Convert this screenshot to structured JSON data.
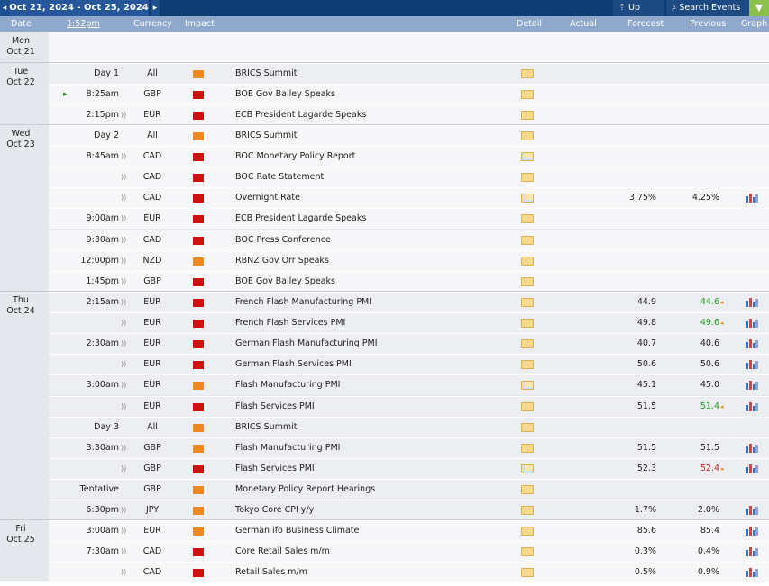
{
  "toolbar": {
    "prev_icon": "◂",
    "date_range": "Oct 21, 2024 - Oct 25, 2024",
    "next_icon": "▸",
    "up_next": "Up Next",
    "search_events": "Search Events",
    "filter_icon": "▼"
  },
  "header": {
    "date": "Date",
    "time": "1:52pm",
    "currency": "Currency",
    "impact": "Impact",
    "detail": "Detail",
    "actual": "Actual",
    "forecast": "Forecast",
    "previous": "Previous",
    "graph": "Graph"
  },
  "colors": {
    "high": "#cc1111",
    "medium": "#ee8822",
    "better": "#1f9e1f",
    "worse": "#cc2222"
  },
  "days": [
    {
      "day": "Mon",
      "date": "Oct 21",
      "rows": []
    },
    {
      "day": "Tue",
      "date": "Oct 22",
      "rows": [
        {
          "time": "Day 1",
          "sound": false,
          "cur": "All",
          "impact": "medium",
          "event": "BRICS Summit",
          "alt": true,
          "forecast": "",
          "previous": "",
          "prev_color": "",
          "graph": false
        },
        {
          "time": "8:25am",
          "sound": false,
          "cur": "GBP",
          "impact": "high",
          "event": "BOE Gov Bailey Speaks",
          "alt": false,
          "forecast": "",
          "previous": "",
          "prev_color": "",
          "graph": false,
          "playing": true
        },
        {
          "time": "2:15pm",
          "sound": true,
          "cur": "EUR",
          "impact": "high",
          "event": "ECB President Lagarde Speaks",
          "alt": false,
          "forecast": "",
          "previous": "",
          "prev_color": "",
          "graph": false
        }
      ]
    },
    {
      "day": "Wed",
      "date": "Oct 23",
      "rows": [
        {
          "time": "Day 2",
          "sound": false,
          "cur": "All",
          "impact": "medium",
          "event": "BRICS Summit",
          "alt": false,
          "forecast": "",
          "previous": "",
          "prev_color": "",
          "graph": false
        },
        {
          "time": "8:45am",
          "sound": true,
          "cur": "CAD",
          "impact": "high",
          "event": "BOC Monetary Policy Report",
          "alt": false,
          "forecast": "",
          "previous": "",
          "prev_color": "",
          "graph": false,
          "doc": true
        },
        {
          "time": "",
          "sound": true,
          "cur": "CAD",
          "impact": "high",
          "event": "BOC Rate Statement",
          "alt": false,
          "forecast": "",
          "previous": "",
          "prev_color": "",
          "graph": false
        },
        {
          "time": "",
          "sound": true,
          "cur": "CAD",
          "impact": "high",
          "event": "Overnight Rate",
          "alt": false,
          "forecast": "3.75%",
          "previous": "4.25%",
          "prev_color": "",
          "graph": true,
          "doc": true
        },
        {
          "time": "9:00am",
          "sound": true,
          "cur": "EUR",
          "impact": "high",
          "event": "ECB President Lagarde Speaks",
          "alt": false,
          "forecast": "",
          "previous": "",
          "prev_color": "",
          "graph": false
        },
        {
          "time": "9:30am",
          "sound": true,
          "cur": "CAD",
          "impact": "high",
          "event": "BOC Press Conference",
          "alt": false,
          "forecast": "",
          "previous": "",
          "prev_color": "",
          "graph": false
        },
        {
          "time": "12:00pm",
          "sound": true,
          "cur": "NZD",
          "impact": "medium",
          "event": "RBNZ Gov Orr Speaks",
          "alt": false,
          "forecast": "",
          "previous": "",
          "prev_color": "",
          "graph": false
        },
        {
          "time": "1:45pm",
          "sound": true,
          "cur": "GBP",
          "impact": "high",
          "event": "BOE Gov Bailey Speaks",
          "alt": false,
          "forecast": "",
          "previous": "",
          "prev_color": "",
          "graph": false
        }
      ]
    },
    {
      "day": "Thu",
      "date": "Oct 24",
      "rows": [
        {
          "time": "2:15am",
          "sound": true,
          "cur": "EUR",
          "impact": "high",
          "event": "French Flash Manufacturing PMI",
          "alt": true,
          "forecast": "44.9",
          "previous": "44.6",
          "prev_color": "better",
          "graph": true
        },
        {
          "time": "",
          "sound": true,
          "cur": "EUR",
          "impact": "high",
          "event": "French Flash Services PMI",
          "alt": true,
          "forecast": "49.8",
          "previous": "49.6",
          "prev_color": "better",
          "graph": true
        },
        {
          "time": "2:30am",
          "sound": true,
          "cur": "EUR",
          "impact": "high",
          "event": "German Flash Manufacturing PMI",
          "alt": true,
          "forecast": "40.7",
          "previous": "40.6",
          "prev_color": "",
          "graph": true
        },
        {
          "time": "",
          "sound": true,
          "cur": "EUR",
          "impact": "high",
          "event": "German Flash Services PMI",
          "alt": true,
          "forecast": "50.6",
          "previous": "50.6",
          "prev_color": "",
          "graph": true
        },
        {
          "time": "3:00am",
          "sound": true,
          "cur": "EUR",
          "impact": "medium",
          "event": "Flash Manufacturing PMI",
          "alt": true,
          "forecast": "45.1",
          "previous": "45.0",
          "prev_color": "",
          "graph": true,
          "doc": true
        },
        {
          "time": "",
          "sound": true,
          "cur": "EUR",
          "impact": "high",
          "event": "Flash Services PMI",
          "alt": true,
          "forecast": "51.5",
          "previous": "51.4",
          "prev_color": "better",
          "graph": true
        },
        {
          "time": "Day 3",
          "sound": false,
          "cur": "All",
          "impact": "medium",
          "event": "BRICS Summit",
          "alt": true,
          "forecast": "",
          "previous": "",
          "prev_color": "",
          "graph": false
        },
        {
          "time": "3:30am",
          "sound": true,
          "cur": "GBP",
          "impact": "medium",
          "event": "Flash Manufacturing PMI",
          "alt": true,
          "forecast": "51.5",
          "previous": "51.5",
          "prev_color": "",
          "graph": true
        },
        {
          "time": "",
          "sound": true,
          "cur": "GBP",
          "impact": "high",
          "event": "Flash Services PMI",
          "alt": true,
          "forecast": "52.3",
          "previous": "52.4",
          "prev_color": "worse",
          "graph": true,
          "doc": true
        },
        {
          "time": "Tentative",
          "sound": false,
          "cur": "GBP",
          "impact": "medium",
          "event": "Monetary Policy Report Hearings",
          "alt": true,
          "forecast": "",
          "previous": "",
          "prev_color": "",
          "graph": false
        },
        {
          "time": "6:30pm",
          "sound": true,
          "cur": "JPY",
          "impact": "medium",
          "event": "Tokyo Core CPI y/y",
          "alt": true,
          "forecast": "1.7%",
          "previous": "2.0%",
          "prev_color": "",
          "graph": true
        }
      ]
    },
    {
      "day": "Fri",
      "date": "Oct 25",
      "rows": [
        {
          "time": "3:00am",
          "sound": true,
          "cur": "EUR",
          "impact": "medium",
          "event": "German ifo Business Climate",
          "alt": false,
          "forecast": "85.6",
          "previous": "85.4",
          "prev_color": "",
          "graph": true
        },
        {
          "time": "7:30am",
          "sound": true,
          "cur": "CAD",
          "impact": "high",
          "event": "Core Retail Sales m/m",
          "alt": false,
          "forecast": "0.3%",
          "previous": "0.4%",
          "prev_color": "",
          "graph": true
        },
        {
          "time": "",
          "sound": true,
          "cur": "CAD",
          "impact": "high",
          "event": "Retail Sales m/m",
          "alt": false,
          "forecast": "0.5%",
          "previous": "0.9%",
          "prev_color": "",
          "graph": true
        }
      ]
    }
  ]
}
